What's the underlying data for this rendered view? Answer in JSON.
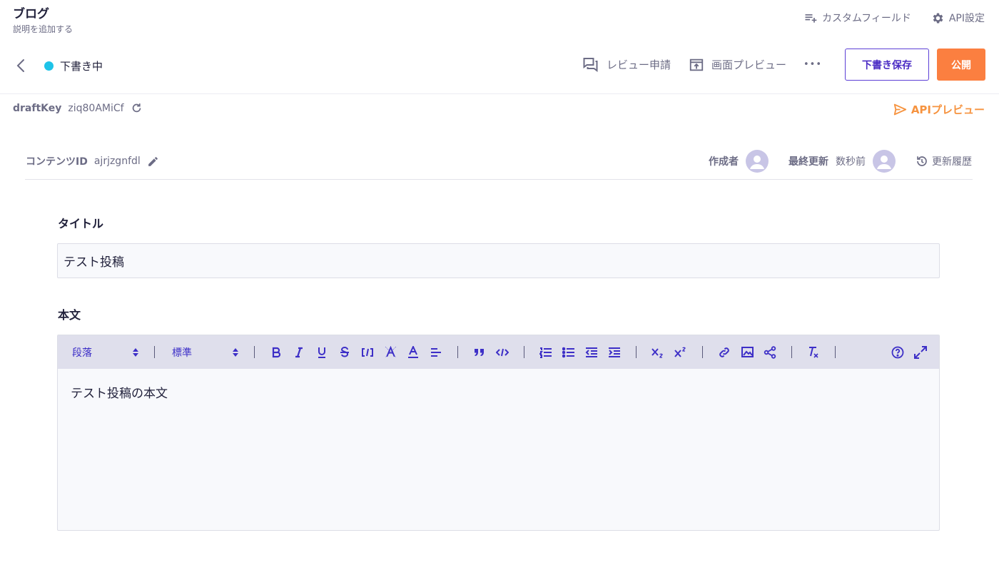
{
  "header": {
    "api_name": "ブログ",
    "api_description": "説明を追加する",
    "custom_field_label": "カスタムフィールド",
    "api_settings_label": "API設定"
  },
  "toolbar": {
    "status_label": "下書き中",
    "review_request_label": "レビュー申請",
    "screen_preview_label": "画面プレビュー",
    "more_label": "•••",
    "save_draft_label": "下書き保存",
    "publish_label": "公開"
  },
  "draft": {
    "key_label": "draftKey",
    "key_value": "ziq80AMiCf",
    "api_preview_label": "APIプレビュー"
  },
  "content": {
    "id_label": "コンテンツID",
    "id_value": "ajrjzgnfdl",
    "author_label": "作成者",
    "updated_label": "最終更新",
    "updated_value": "数秒前",
    "history_label": "更新履歴"
  },
  "fields": {
    "title_label": "タイトル",
    "title_value": "テスト投稿",
    "body_label": "本文",
    "body_value": "テスト投稿の本文"
  },
  "editor_toolbar": {
    "block_select": "段落",
    "size_select": "標準"
  },
  "colors": {
    "accent": "#3d2fc7",
    "publish": "#fb7f40",
    "status_dot": "#1ec3e8",
    "api_preview": "#f6933f"
  }
}
